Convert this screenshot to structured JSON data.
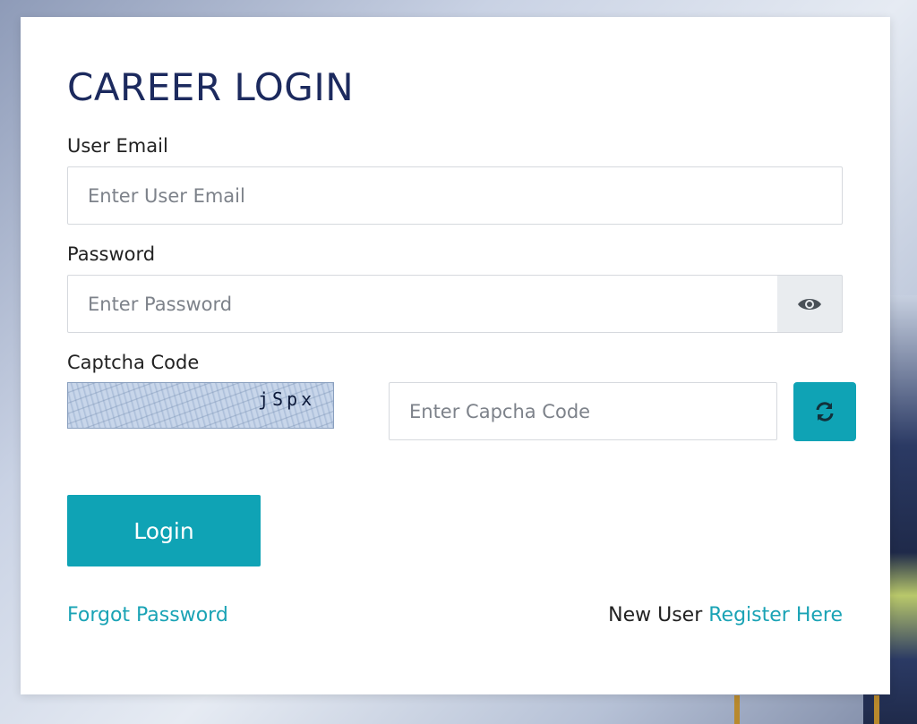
{
  "page": {
    "title": "CAREER LOGIN"
  },
  "form": {
    "email_label": "User Email",
    "email_placeholder": "Enter User Email",
    "email_value": "",
    "password_label": "Password",
    "password_placeholder": "Enter Password",
    "password_value": "",
    "captcha_label": "Captcha Code",
    "captcha_text": "jSpx",
    "captcha_placeholder": "Enter Capcha Code",
    "captcha_value": "",
    "login_label": "Login"
  },
  "footer": {
    "forgot_label": "Forgot Password",
    "new_user_text": "New User",
    "register_label": "Register Here"
  },
  "icons": {
    "password_toggle": "eye-icon",
    "captcha_refresh": "refresh-icon"
  },
  "colors": {
    "accent": "#0fa3b5",
    "title": "#1c2a5e",
    "link": "#1aa3b5"
  }
}
